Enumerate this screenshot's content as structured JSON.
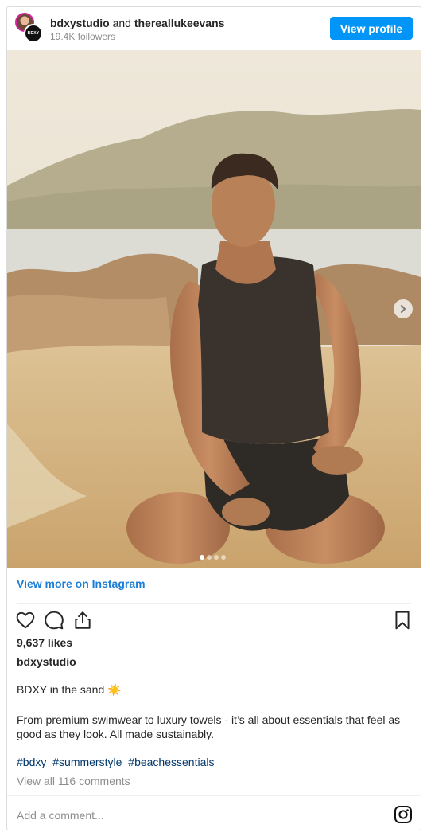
{
  "header": {
    "brand_avatar_text": "BDXY",
    "account1": "bdxystudio",
    "and_text": "and",
    "account2": "thereallukeevans",
    "followers": "19.4K followers",
    "view_profile_label": "View profile"
  },
  "post": {
    "carousel": {
      "slide_count": 4,
      "active_slide": 1
    },
    "view_more_label": "View more on Instagram",
    "likes": "9,637 likes",
    "username": "bdxystudio",
    "caption_line1": "BDXY in the sand ☀️",
    "caption_line2": "From premium swimwear to luxury towels - it’s all about essentials that feel as good as they look. All made sustainably.",
    "hashtags": [
      "#bdxy",
      "#summerstyle",
      "#beachessentials"
    ],
    "comments_link": "View all 116 comments",
    "comment_placeholder": "Add a comment..."
  },
  "icons": [
    "heart-icon",
    "comment-icon",
    "share-icon",
    "bookmark-icon",
    "chevron-right-icon",
    "instagram-icon"
  ],
  "colors": {
    "primary_button": "#0095f6",
    "link": "#1c7ed6",
    "hashtag": "#00376b",
    "muted": "#8e8e8e"
  }
}
